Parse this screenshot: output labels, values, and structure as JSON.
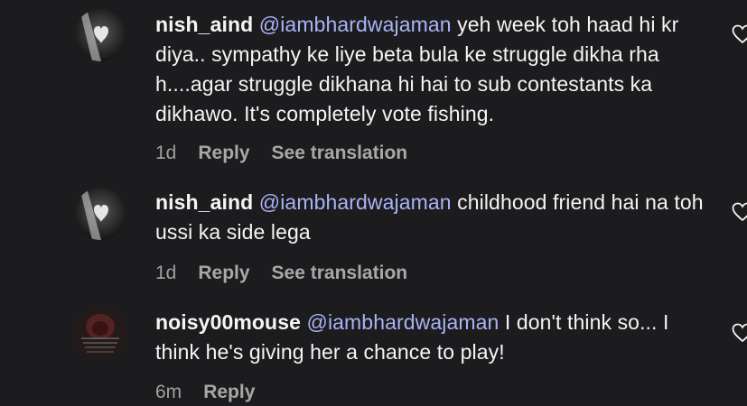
{
  "comments": [
    {
      "username": "nish_aind",
      "mention": "@iambhardwajaman",
      "text": " yeh week toh haad hi kr diya.. sympathy ke liye beta bula ke struggle dikha rha h....agar struggle dikhana hi hai to sub contestants ka dikhawo. It's completely vote fishing.",
      "time": "1d",
      "reply": "Reply",
      "translate": "See translation",
      "icon": "heart-outline-icon"
    },
    {
      "username": "nish_aind",
      "mention": "@iambhardwajaman",
      "text": " childhood friend hai na toh ussi ka side lega",
      "time": "1d",
      "reply": "Reply",
      "translate": "See translation",
      "icon": "heart-outline-icon"
    },
    {
      "username": "noisy00mouse",
      "mention": "@iambhardwajaman",
      "text": " I don't think so... I think he's giving her a chance to play!",
      "time": "6m",
      "reply": "Reply",
      "icon": "heart-outline-icon"
    }
  ],
  "colors": {
    "background": "#1c1c1e",
    "text": "#f5f5f5",
    "mention": "#a9b3f5",
    "meta": "#a0a0a0"
  }
}
